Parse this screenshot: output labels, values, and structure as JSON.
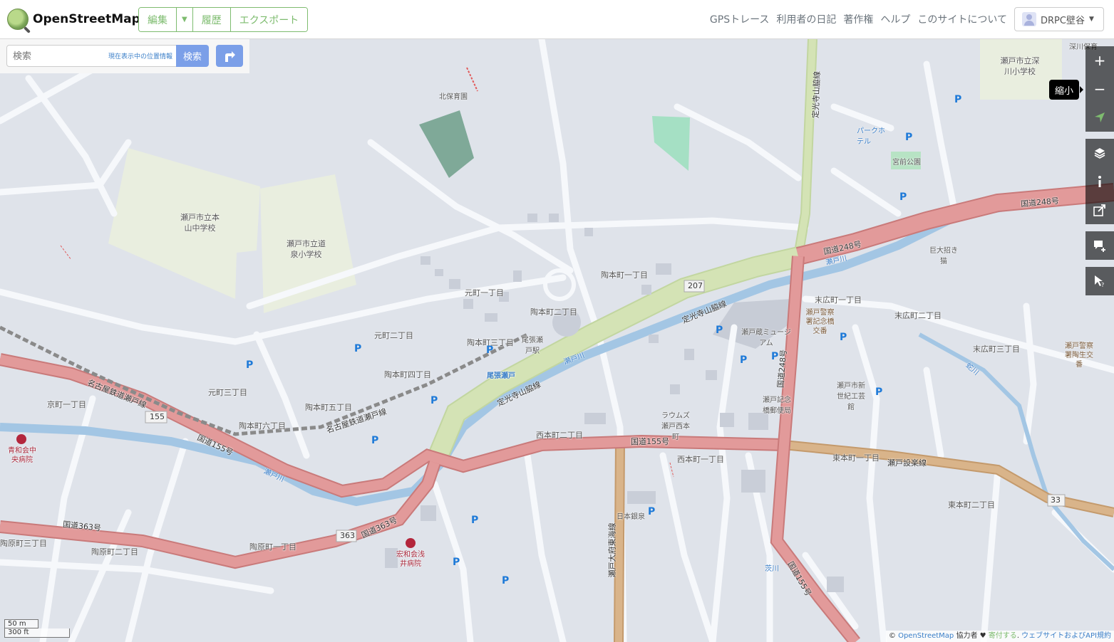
{
  "header": {
    "logo_text": "OpenStreetMap",
    "edit": "編集",
    "history": "履歴",
    "export": "エクスポート",
    "nav": [
      "GPSトレース",
      "利用者の日記",
      "著作権",
      "ヘルプ",
      "このサイトについて"
    ],
    "user": "DRPC壁谷"
  },
  "search": {
    "placeholder": "検索",
    "hint": "現在表示中の位置情報",
    "button": "検索"
  },
  "controls": {
    "zoom_in": "+",
    "zoom_out": "−",
    "tooltip": "縮小"
  },
  "scale": {
    "metric": "50 m",
    "imperial": "300 ft"
  },
  "attribution": {
    "copy": "©",
    "osm": "OpenStreetMap",
    "contributors": "協力者",
    "heart": "♥",
    "donate": "寄付する",
    "tail": "ウェブサイトおよびAPI規約"
  },
  "map_labels": {
    "kitahoikuen": "北保育園",
    "school1": "瀬戸市立本山中学校",
    "school2": "瀬戸市立道泉小学校",
    "school3": "瀬戸市立深川小学校",
    "fukagawa_hoiku": "深川保育",
    "park_hotel": "パークホテル",
    "miyamae_park": "宮前公園",
    "route248_top": "国道248号",
    "setogawa": "瀬戸川",
    "route248_mid": "国道248号",
    "kodaimaneki": "巨大招き猫",
    "suehiro1": "末広町一丁目",
    "suehiro2": "末広町二丁目",
    "suehiro3": "末広町三丁目",
    "police_kinenkyo": "瀬戸警察署記念橋交番",
    "police_miyamae": "瀬戸警察署陶生交番",
    "setogura": "瀬戸蔵ミュージアム",
    "jokoji_top": "定光寺山脇線",
    "jokoji_mid": "定光寺山脇線",
    "jokoji_low": "定光寺山脇線",
    "suemachi1": "陶本町一丁目",
    "suemachi2": "陶本町二丁目",
    "suemachi3": "陶本町三丁目",
    "suemachi4": "陶本町四丁目",
    "suemachi5": "陶本町五丁目",
    "suemachi6": "陶本町六丁目",
    "motomachi1": "元町一丁目",
    "motomachi2": "元町二丁目",
    "motomachi3": "元町三丁目",
    "kyomachi1": "京町一丁目",
    "owari_seto_station": "尾張瀬戸駅",
    "owari_seto": "尾張瀬戸",
    "meitetsu1": "名古屋鉄道瀬戸線",
    "meitetsu2": "名古屋鉄道瀬戸線",
    "route155": "国道155号",
    "route155_mid": "国道155号",
    "route155_low": "国道155号",
    "route363": "国道363号",
    "nishihonmachi2": "西本町二丁目",
    "nishihonmachi1": "西本町一丁目",
    "higashihonmachi1": "東本町一丁目",
    "higashihonmachi2": "東本町二丁目",
    "setokaisen": "瀬戸設楽線",
    "seiwakai": "青和会中央病院",
    "kowakai": "宏和会浅井病院",
    "nihonginko": "日本銀泉",
    "shinseiki": "瀬戸市新世紀工芸館",
    "kinenkyo_post": "瀬戸記念橋郵便局",
    "laum": "ラウムズ瀬戸西本町",
    "seto_ohfu": "瀬戸大府東海線",
    "jokoji_vert": "定光寺山脇線",
    "tohara1": "陶原町一丁目",
    "tohara2": "陶原町二丁目",
    "tohara3": "陶原町三丁目",
    "sanagawa": "蛇川",
    "shiokawa": "茨川",
    "shield155": "155",
    "shield207": "207",
    "shield363": "363",
    "shield33": "33"
  },
  "colors": {
    "accent_green": "#7ebc6f",
    "primary_road": "#e29a9a",
    "secondary_road": "#d4e3b5",
    "tertiary_road": "#d9b48a",
    "river": "#a3c6e4",
    "school_area": "#e9eedf",
    "park_area": "#a5e0c4",
    "search_blue": "#7b9fe8"
  }
}
